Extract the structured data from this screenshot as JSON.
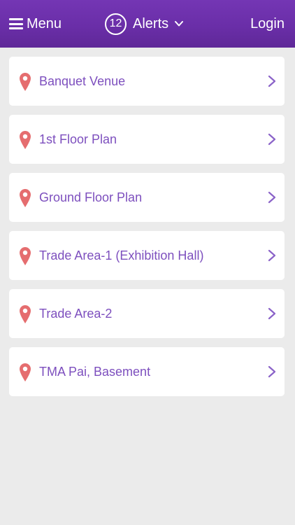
{
  "header": {
    "menu_label": "Menu",
    "alerts_count": "12",
    "alerts_label": "Alerts",
    "login_label": "Login"
  },
  "colors": {
    "header_bg": "#6a2ea8",
    "item_text": "#7d4fbe",
    "pin": "#e56d6f",
    "chevron": "#8a62c8",
    "page_bg": "#ebebeb"
  },
  "icons": {
    "menu": "hamburger-icon",
    "alerts_dropdown": "chevron-down-icon",
    "location": "map-pin-icon",
    "navigate": "chevron-right-icon"
  },
  "venues": [
    {
      "label": "Banquet Venue"
    },
    {
      "label": "1st Floor Plan"
    },
    {
      "label": "Ground Floor Plan"
    },
    {
      "label": "Trade Area-1 (Exhibition Hall)"
    },
    {
      "label": "Trade Area-2"
    },
    {
      "label": "TMA Pai, Basement"
    }
  ]
}
